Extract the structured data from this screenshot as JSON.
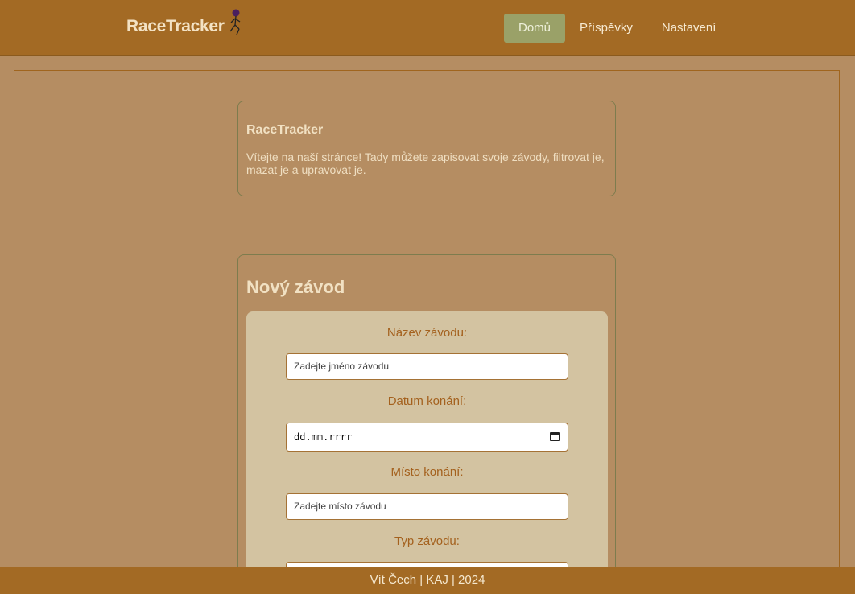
{
  "header": {
    "logo_text": "RaceTracker",
    "logo_icon": "running-figure-icon",
    "nav": [
      {
        "label": "Domů",
        "active": true
      },
      {
        "label": "Příspěvky",
        "active": false
      },
      {
        "label": "Nastavení",
        "active": false
      }
    ]
  },
  "intro": {
    "title": "RaceTracker",
    "text": "Vítejte na naší stránce! Tady můžete zapisovat svoje závody, filtrovat je, mazat je a upravovat je."
  },
  "new_race": {
    "title": "Nový závod",
    "name_label": "Název závodu:",
    "name_placeholder": "Zadejte jméno závodu",
    "date_label": "Datum konání:",
    "date_placeholder": "dd.mm.rrrr",
    "place_label": "Místo konání:",
    "place_placeholder": "Zadejte místo závodu",
    "type_label": "Typ závodu:"
  },
  "footer": {
    "text": "Vít Čech | KAJ | 2024"
  },
  "colors": {
    "header_bg": "#a36a24",
    "page_bg": "#b58d62",
    "active_nav": "#9aa168",
    "form_panel": "#d3c3a1",
    "label_text": "#a4611e"
  }
}
